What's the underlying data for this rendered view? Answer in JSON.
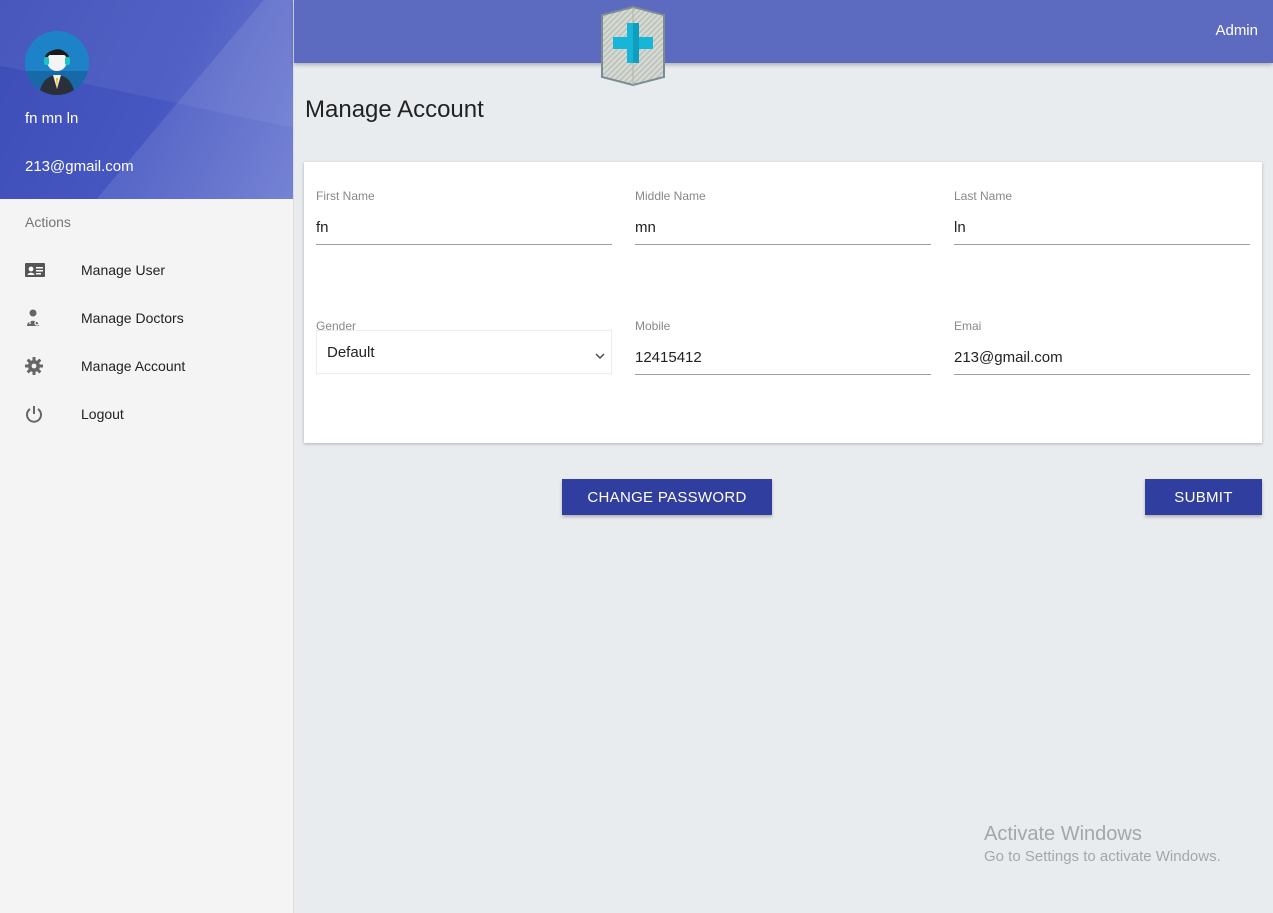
{
  "profile": {
    "name": "fn mn ln",
    "email": "213@gmail.com"
  },
  "sidebar": {
    "section_label": "Actions",
    "items": [
      {
        "label": "Manage User",
        "icon": "id-card-icon"
      },
      {
        "label": "Manage Doctors",
        "icon": "doctor-icon"
      },
      {
        "label": "Manage Account",
        "icon": "gear-icon"
      },
      {
        "label": "Logout",
        "icon": "power-icon"
      }
    ]
  },
  "header": {
    "user_label": "Admin",
    "logo_icon": "medical-cross-icon"
  },
  "main": {
    "title": "Manage Account",
    "fields": {
      "first_name": {
        "label": "First Name",
        "value": "fn"
      },
      "middle_name": {
        "label": "Middle Name",
        "value": "mn"
      },
      "last_name": {
        "label": "Last Name",
        "value": "ln"
      },
      "gender": {
        "label": "Gender",
        "value": "Default"
      },
      "mobile": {
        "label": "Mobile",
        "value": "12415412"
      },
      "email": {
        "label": "Emai",
        "value": "213@gmail.com"
      }
    },
    "change_password_label": "CHANGE PASSWORD",
    "submit_label": "SUBMIT"
  },
  "watermark": {
    "title": "Activate Windows",
    "subtitle": "Go to Settings to activate Windows."
  },
  "colors": {
    "topbar": "#5c6bc0",
    "button": "#303f9f",
    "background": "#e9ecef"
  }
}
